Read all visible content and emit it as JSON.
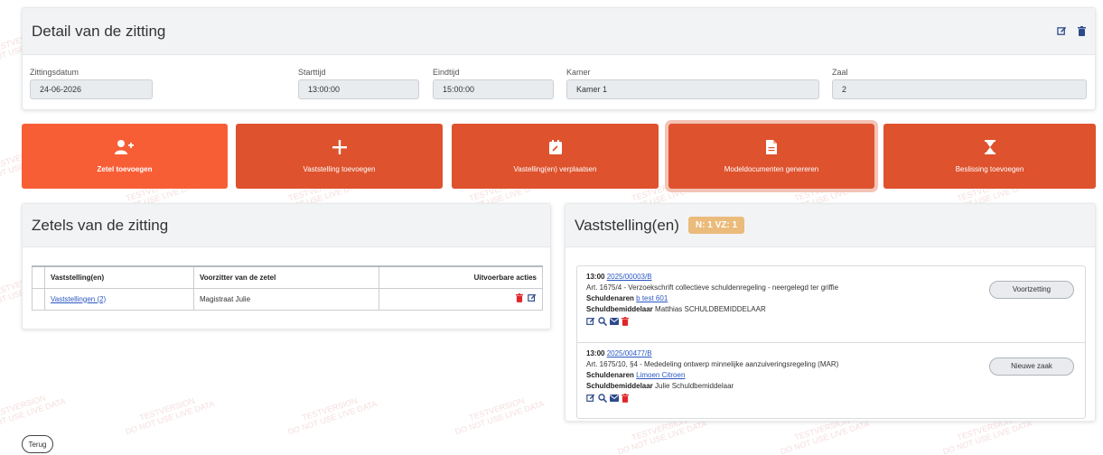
{
  "watermark": {
    "line1": "TESTVERSION",
    "line2": "DO NOT USE LIVE DATA"
  },
  "detail": {
    "title": "Detail van de zitting",
    "fields": {
      "datum": {
        "label": "Zittingsdatum",
        "value": "24-06-2026"
      },
      "start": {
        "label": "Starttijd",
        "value": "13:00:00"
      },
      "eind": {
        "label": "Eindtijd",
        "value": "15:00:00"
      },
      "kamer": {
        "label": "Kamer",
        "value": "Kamer 1"
      },
      "zaal": {
        "label": "Zaal",
        "value": "2"
      }
    }
  },
  "actions": [
    {
      "label": "Zetel toevoegen",
      "icon": "user-plus-icon"
    },
    {
      "label": "Vaststelling toevoegen",
      "icon": "plus-icon"
    },
    {
      "label": "Vastelling(en) verplaatsen",
      "icon": "calendar-edit-icon"
    },
    {
      "label": "Modeldocumenten genereren",
      "icon": "file-icon"
    },
    {
      "label": "Beslissing toevoegen",
      "icon": "hourglass-icon"
    }
  ],
  "zetels": {
    "title": "Zetels van de zitting",
    "columns": [
      "Vaststelling(en)",
      "Voorzitter van de zetel",
      "Uitvoerbare acties"
    ],
    "rows": [
      {
        "vaststellingen": "Vaststellingen (2)",
        "voorzitter": "Magistraat Julie"
      }
    ]
  },
  "vaststellingen": {
    "title": "Vaststelling(en)",
    "badge": "N: 1 VZ: 1",
    "items": [
      {
        "time": "13:00",
        "case": "2025/00003/B",
        "desc": "Art. 1675/4 - Verzoekschrift collectieve schuldenregeling - neergelegd ter griffie",
        "schuldenaren_label": "Schuldenaren",
        "schuldenaren": "b test 601",
        "bemiddelaar_label": "Schuldbemiddelaar",
        "bemiddelaar": "Matthias SCHULDBEMIDDELAAR",
        "status": "Voortzetting"
      },
      {
        "time": "13:00",
        "case": "2025/00477/B",
        "desc": "Art. 1675/10, §4 - Mededeling ontwerp minnelijke aanzuiveringsregeling (MAR)",
        "schuldenaren_label": "Schuldenaren",
        "schuldenaren": "Limoen Citroen",
        "bemiddelaar_label": "Schuldbemiddelaar",
        "bemiddelaar": "Julie Schuldbemiddelaar",
        "status": "Nieuwe zaak"
      }
    ]
  },
  "back_label": "Terug",
  "colors": {
    "accent": "#de522e",
    "accent_light": "#f85e36",
    "badge": "#ebbb7c",
    "link": "#2a57c2",
    "delete": "#e0262b",
    "primary_icon": "#2c4a8a"
  }
}
